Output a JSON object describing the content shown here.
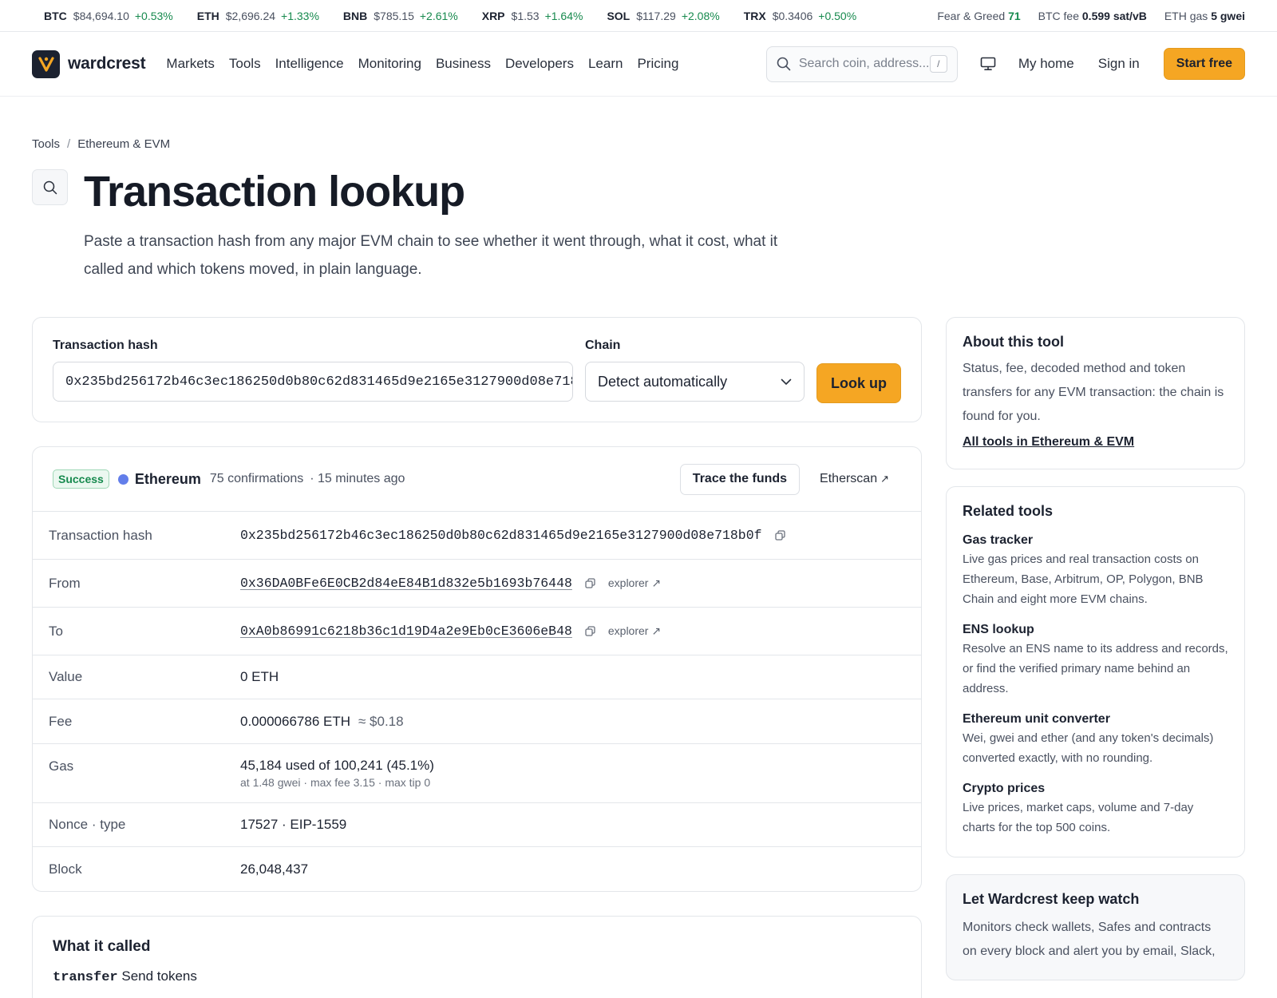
{
  "ticker": {
    "coins": [
      {
        "sym": "BTC",
        "price": "$84,694.10",
        "change": "+0.53%"
      },
      {
        "sym": "ETH",
        "price": "$2,696.24",
        "change": "+1.33%"
      },
      {
        "sym": "BNB",
        "price": "$785.15",
        "change": "+2.61%"
      },
      {
        "sym": "XRP",
        "price": "$1.53",
        "change": "+1.64%"
      },
      {
        "sym": "SOL",
        "price": "$117.29",
        "change": "+2.08%"
      },
      {
        "sym": "TRX",
        "price": "$0.3406",
        "change": "+0.50%"
      }
    ],
    "fear_label": "Fear & Greed",
    "fear_value": "71",
    "btc_fee_label": "BTC fee",
    "btc_fee_value": "0.599 sat/vB",
    "eth_gas_label": "ETH gas",
    "eth_gas_value": "5 gwei"
  },
  "header": {
    "brand": "wardcrest",
    "nav": [
      "Markets",
      "Tools",
      "Intelligence",
      "Monitoring",
      "Business",
      "Developers",
      "Learn",
      "Pricing"
    ],
    "search_placeholder": "Search coin, address...",
    "search_shortcut": "/",
    "my_home": "My home",
    "sign_in": "Sign in",
    "start_free": "Start free"
  },
  "breadcrumb": {
    "parent": "Tools",
    "sep": "/",
    "current": "Ethereum & EVM"
  },
  "page": {
    "title": "Transaction lookup",
    "lede": "Paste a transaction hash from any major EVM chain to see whether it went through, what it cost, what it called and which tokens moved, in plain language."
  },
  "form": {
    "hash_label": "Transaction hash",
    "hash_value": "0x235bd256172b46c3ec186250d0b80c62d831465d9e2165e3127900d08e718b0f",
    "chain_label": "Chain",
    "chain_value": "Detect automatically",
    "submit": "Look up"
  },
  "result": {
    "status": "Success",
    "chain": "Ethereum",
    "confirmations": "75 confirmations",
    "ago": "· 15 minutes ago",
    "trace": "Trace the funds",
    "explorer_link": "Etherscan",
    "rows": {
      "hash": {
        "label": "Transaction hash",
        "value": "0x235bd256172b46c3ec186250d0b80c62d831465d9e2165e3127900d08e718b0f"
      },
      "from": {
        "label": "From",
        "value": "0x36DA0BFe6E0CB2d84eE84B1d832e5b1693b76448",
        "link": "explorer"
      },
      "to": {
        "label": "To",
        "value": "0xA0b86991c6218b36c1d19D4a2e9Eb0cE3606eB48",
        "link": "explorer"
      },
      "value": {
        "label": "Value",
        "value": "0 ETH"
      },
      "fee": {
        "label": "Fee",
        "value": "0.000066786 ETH",
        "usd": "≈ $0.18"
      },
      "gas": {
        "label": "Gas",
        "value": "45,184 used of 100,241 (45.1%)",
        "detail": "at 1.48 gwei · max fee 3.15 · max tip 0"
      },
      "nonce": {
        "label": "Nonce · type",
        "value": "17527 · EIP-1559"
      },
      "block": {
        "label": "Block",
        "value": "26,048,437"
      }
    }
  },
  "called": {
    "title": "What it called",
    "fn": "transfer",
    "desc": "Send tokens"
  },
  "sidebar": {
    "about": {
      "title": "About this tool",
      "text": "Status, fee, decoded method and token transfers for any EVM transaction: the chain is found for you.",
      "link": "All tools in Ethereum & EVM"
    },
    "related": {
      "title": "Related tools",
      "tools": [
        {
          "name": "Gas tracker",
          "desc": "Live gas prices and real transaction costs on Ethereum, Base, Arbitrum, OP, Polygon, BNB Chain and eight more EVM chains."
        },
        {
          "name": "ENS lookup",
          "desc": "Resolve an ENS name to its address and records, or find the verified primary name behind an address."
        },
        {
          "name": "Ethereum unit converter",
          "desc": "Wei, gwei and ether (and any token's decimals) converted exactly, with no rounding."
        },
        {
          "name": "Crypto prices",
          "desc": "Live prices, market caps, volume and 7-day charts for the top 500 coins."
        }
      ]
    },
    "keep": {
      "title": "Let Wardcrest keep watch",
      "text": "Monitors check wallets, Safes and contracts on every block and alert you by email, Slack,"
    }
  },
  "colors": {
    "accent": "#f5a623",
    "success": "#178a4e",
    "ethereum": "#627eea",
    "text": "#1c2230"
  }
}
